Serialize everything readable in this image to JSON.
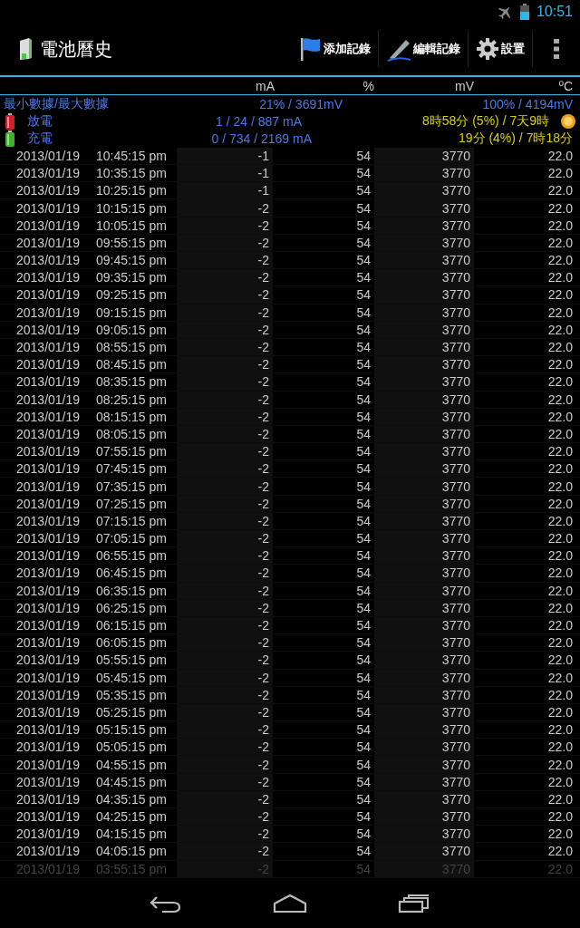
{
  "status_bar": {
    "time": "10:51"
  },
  "action_bar": {
    "title": "電池曆史",
    "actions": [
      {
        "label": "添加記錄",
        "kind": "flag"
      },
      {
        "label": "編輯記錄",
        "kind": "pen"
      },
      {
        "label": "設置",
        "kind": "gear"
      }
    ]
  },
  "table": {
    "columns": [
      "mA",
      "%",
      "mV",
      "ºC"
    ],
    "summary": [
      {
        "kind": "minmax",
        "label": "最小數據/最大數據",
        "middle": "21% / 3691mV",
        "right": "100% / 4194mV"
      },
      {
        "kind": "discharge",
        "label": "放電",
        "middle": "1 / 24 / 887 mA",
        "right": "8時58分 (5%) / 7天9時"
      },
      {
        "kind": "charge",
        "label": "充電",
        "middle": "0 / 734 / 2169 mA",
        "right": "19分 (4%) / 7時18分"
      }
    ],
    "rows": [
      {
        "date": "2013/01/19",
        "time": "10:45:15 pm",
        "ma": "-1",
        "pct": "54",
        "mv": "3770",
        "temp": "22.0",
        "faded": false
      },
      {
        "date": "2013/01/19",
        "time": "10:35:15 pm",
        "ma": "-1",
        "pct": "54",
        "mv": "3770",
        "temp": "22.0",
        "faded": false
      },
      {
        "date": "2013/01/19",
        "time": "10:25:15 pm",
        "ma": "-1",
        "pct": "54",
        "mv": "3770",
        "temp": "22.0",
        "faded": false
      },
      {
        "date": "2013/01/19",
        "time": "10:15:15 pm",
        "ma": "-2",
        "pct": "54",
        "mv": "3770",
        "temp": "22.0",
        "faded": false
      },
      {
        "date": "2013/01/19",
        "time": "10:05:15 pm",
        "ma": "-2",
        "pct": "54",
        "mv": "3770",
        "temp": "22.0",
        "faded": false
      },
      {
        "date": "2013/01/19",
        "time": "09:55:15 pm",
        "ma": "-2",
        "pct": "54",
        "mv": "3770",
        "temp": "22.0",
        "faded": false
      },
      {
        "date": "2013/01/19",
        "time": "09:45:15 pm",
        "ma": "-2",
        "pct": "54",
        "mv": "3770",
        "temp": "22.0",
        "faded": false
      },
      {
        "date": "2013/01/19",
        "time": "09:35:15 pm",
        "ma": "-2",
        "pct": "54",
        "mv": "3770",
        "temp": "22.0",
        "faded": false
      },
      {
        "date": "2013/01/19",
        "time": "09:25:15 pm",
        "ma": "-2",
        "pct": "54",
        "mv": "3770",
        "temp": "22.0",
        "faded": false
      },
      {
        "date": "2013/01/19",
        "time": "09:15:15 pm",
        "ma": "-2",
        "pct": "54",
        "mv": "3770",
        "temp": "22.0",
        "faded": false
      },
      {
        "date": "2013/01/19",
        "time": "09:05:15 pm",
        "ma": "-2",
        "pct": "54",
        "mv": "3770",
        "temp": "22.0",
        "faded": false
      },
      {
        "date": "2013/01/19",
        "time": "08:55:15 pm",
        "ma": "-2",
        "pct": "54",
        "mv": "3770",
        "temp": "22.0",
        "faded": false
      },
      {
        "date": "2013/01/19",
        "time": "08:45:15 pm",
        "ma": "-2",
        "pct": "54",
        "mv": "3770",
        "temp": "22.0",
        "faded": false
      },
      {
        "date": "2013/01/19",
        "time": "08:35:15 pm",
        "ma": "-2",
        "pct": "54",
        "mv": "3770",
        "temp": "22.0",
        "faded": false
      },
      {
        "date": "2013/01/19",
        "time": "08:25:15 pm",
        "ma": "-2",
        "pct": "54",
        "mv": "3770",
        "temp": "22.0",
        "faded": false
      },
      {
        "date": "2013/01/19",
        "time": "08:15:15 pm",
        "ma": "-2",
        "pct": "54",
        "mv": "3770",
        "temp": "22.0",
        "faded": false
      },
      {
        "date": "2013/01/19",
        "time": "08:05:15 pm",
        "ma": "-2",
        "pct": "54",
        "mv": "3770",
        "temp": "22.0",
        "faded": false
      },
      {
        "date": "2013/01/19",
        "time": "07:55:15 pm",
        "ma": "-2",
        "pct": "54",
        "mv": "3770",
        "temp": "22.0",
        "faded": false
      },
      {
        "date": "2013/01/19",
        "time": "07:45:15 pm",
        "ma": "-2",
        "pct": "54",
        "mv": "3770",
        "temp": "22.0",
        "faded": false
      },
      {
        "date": "2013/01/19",
        "time": "07:35:15 pm",
        "ma": "-2",
        "pct": "54",
        "mv": "3770",
        "temp": "22.0",
        "faded": false
      },
      {
        "date": "2013/01/19",
        "time": "07:25:15 pm",
        "ma": "-2",
        "pct": "54",
        "mv": "3770",
        "temp": "22.0",
        "faded": false
      },
      {
        "date": "2013/01/19",
        "time": "07:15:15 pm",
        "ma": "-2",
        "pct": "54",
        "mv": "3770",
        "temp": "22.0",
        "faded": false
      },
      {
        "date": "2013/01/19",
        "time": "07:05:15 pm",
        "ma": "-2",
        "pct": "54",
        "mv": "3770",
        "temp": "22.0",
        "faded": false
      },
      {
        "date": "2013/01/19",
        "time": "06:55:15 pm",
        "ma": "-2",
        "pct": "54",
        "mv": "3770",
        "temp": "22.0",
        "faded": false
      },
      {
        "date": "2013/01/19",
        "time": "06:45:15 pm",
        "ma": "-2",
        "pct": "54",
        "mv": "3770",
        "temp": "22.0",
        "faded": false
      },
      {
        "date": "2013/01/19",
        "time": "06:35:15 pm",
        "ma": "-2",
        "pct": "54",
        "mv": "3770",
        "temp": "22.0",
        "faded": false
      },
      {
        "date": "2013/01/19",
        "time": "06:25:15 pm",
        "ma": "-2",
        "pct": "54",
        "mv": "3770",
        "temp": "22.0",
        "faded": false
      },
      {
        "date": "2013/01/19",
        "time": "06:15:15 pm",
        "ma": "-2",
        "pct": "54",
        "mv": "3770",
        "temp": "22.0",
        "faded": false
      },
      {
        "date": "2013/01/19",
        "time": "06:05:15 pm",
        "ma": "-2",
        "pct": "54",
        "mv": "3770",
        "temp": "22.0",
        "faded": false
      },
      {
        "date": "2013/01/19",
        "time": "05:55:15 pm",
        "ma": "-2",
        "pct": "54",
        "mv": "3770",
        "temp": "22.0",
        "faded": false
      },
      {
        "date": "2013/01/19",
        "time": "05:45:15 pm",
        "ma": "-2",
        "pct": "54",
        "mv": "3770",
        "temp": "22.0",
        "faded": false
      },
      {
        "date": "2013/01/19",
        "time": "05:35:15 pm",
        "ma": "-2",
        "pct": "54",
        "mv": "3770",
        "temp": "22.0",
        "faded": false
      },
      {
        "date": "2013/01/19",
        "time": "05:25:15 pm",
        "ma": "-2",
        "pct": "54",
        "mv": "3770",
        "temp": "22.0",
        "faded": false
      },
      {
        "date": "2013/01/19",
        "time": "05:15:15 pm",
        "ma": "-2",
        "pct": "54",
        "mv": "3770",
        "temp": "22.0",
        "faded": false
      },
      {
        "date": "2013/01/19",
        "time": "05:05:15 pm",
        "ma": "-2",
        "pct": "54",
        "mv": "3770",
        "temp": "22.0",
        "faded": false
      },
      {
        "date": "2013/01/19",
        "time": "04:55:15 pm",
        "ma": "-2",
        "pct": "54",
        "mv": "3770",
        "temp": "22.0",
        "faded": false
      },
      {
        "date": "2013/01/19",
        "time": "04:45:15 pm",
        "ma": "-2",
        "pct": "54",
        "mv": "3770",
        "temp": "22.0",
        "faded": false
      },
      {
        "date": "2013/01/19",
        "time": "04:35:15 pm",
        "ma": "-2",
        "pct": "54",
        "mv": "3770",
        "temp": "22.0",
        "faded": false
      },
      {
        "date": "2013/01/19",
        "time": "04:25:15 pm",
        "ma": "-2",
        "pct": "54",
        "mv": "3770",
        "temp": "22.0",
        "faded": false
      },
      {
        "date": "2013/01/19",
        "time": "04:15:15 pm",
        "ma": "-2",
        "pct": "54",
        "mv": "3770",
        "temp": "22.0",
        "faded": false
      },
      {
        "date": "2013/01/19",
        "time": "04:05:15 pm",
        "ma": "-2",
        "pct": "54",
        "mv": "3770",
        "temp": "22.0",
        "faded": false
      },
      {
        "date": "2013/01/19",
        "time": "03:55:15 pm",
        "ma": "-2",
        "pct": "54",
        "mv": "3770",
        "temp": "22.0",
        "faded": true
      }
    ]
  }
}
